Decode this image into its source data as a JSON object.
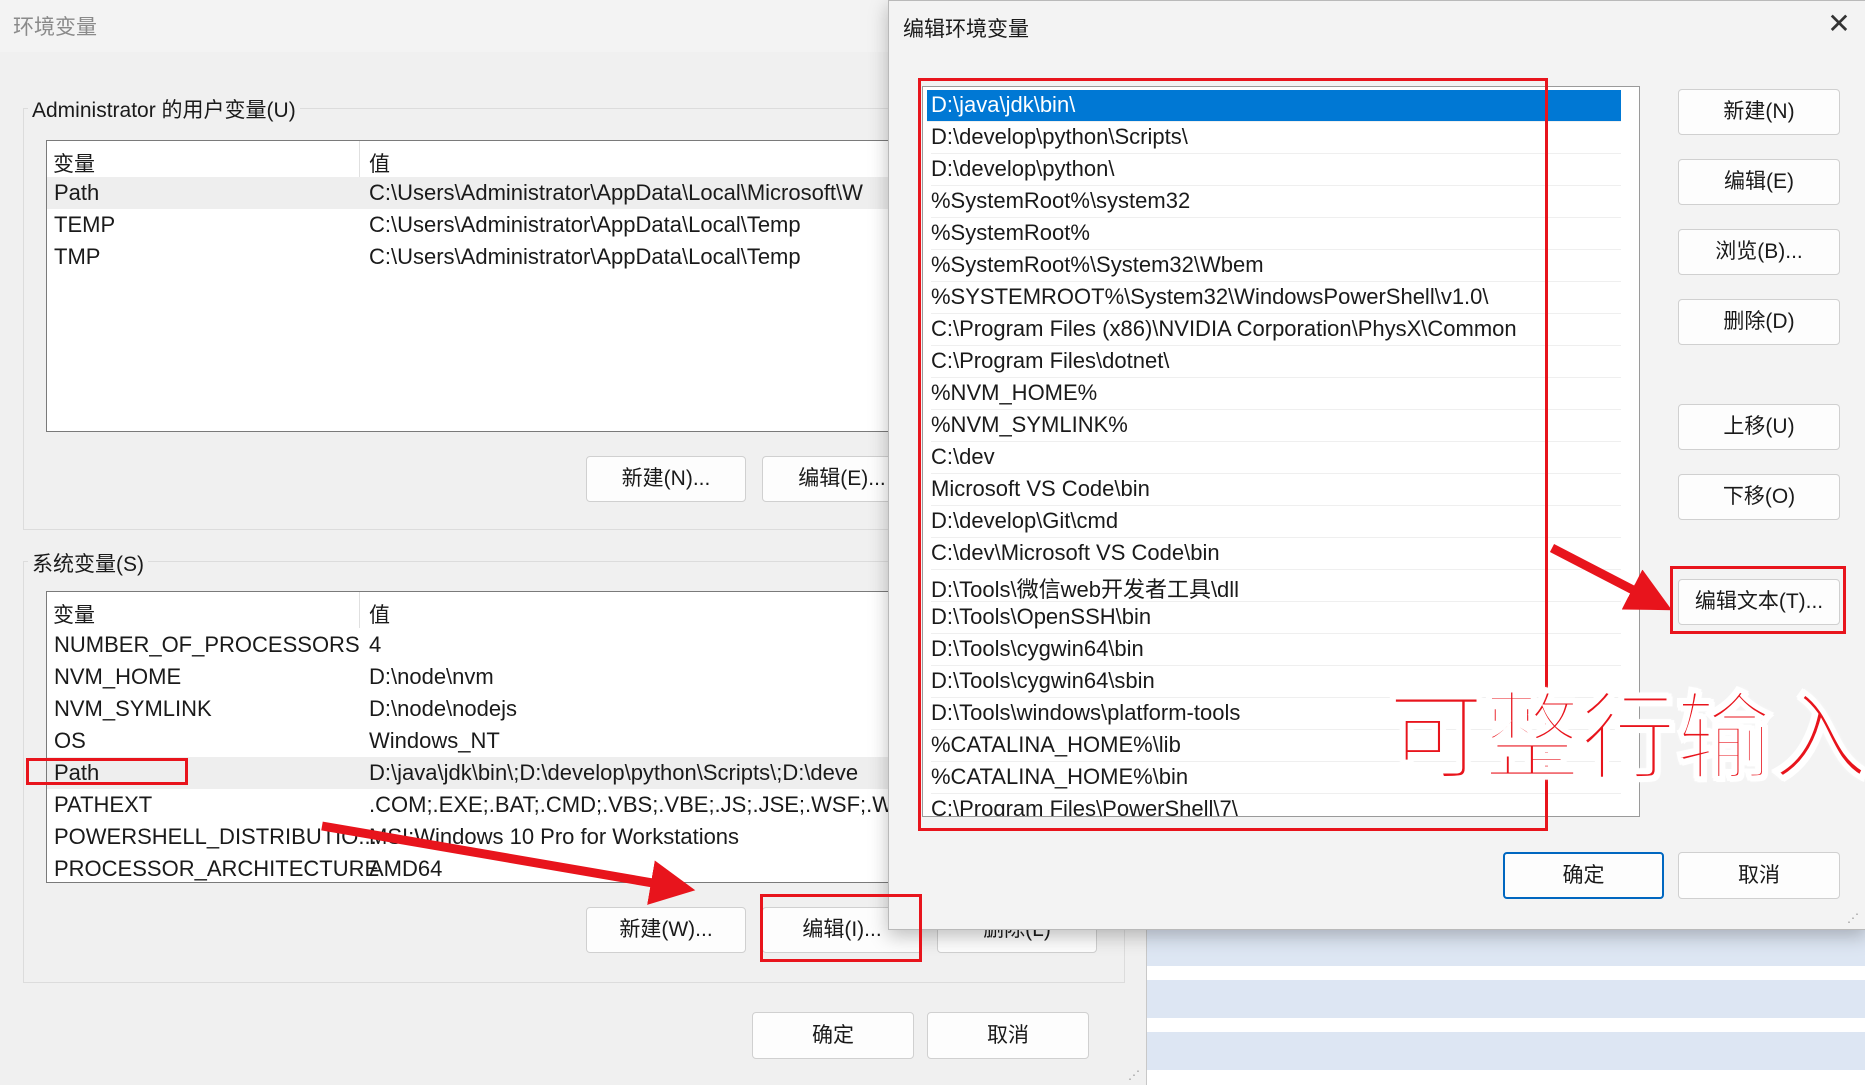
{
  "env_window": {
    "title": "环境变量",
    "user_group_label": "Administrator 的用户变量(U)",
    "columns": [
      "变量",
      "值"
    ],
    "user_vars": [
      {
        "name": "Path",
        "value": "C:\\Users\\Administrator\\AppData\\Local\\Microsoft\\W"
      },
      {
        "name": "TEMP",
        "value": "C:\\Users\\Administrator\\AppData\\Local\\Temp"
      },
      {
        "name": "TMP",
        "value": "C:\\Users\\Administrator\\AppData\\Local\\Temp"
      }
    ],
    "user_buttons": {
      "new": "新建(N)...",
      "edit": "编辑(E)..."
    },
    "system_group_label": "系统变量(S)",
    "system_vars": [
      {
        "name": "NUMBER_OF_PROCESSORS",
        "value": "4"
      },
      {
        "name": "NVM_HOME",
        "value": "D:\\node\\nvm"
      },
      {
        "name": "NVM_SYMLINK",
        "value": "D:\\node\\nodejs"
      },
      {
        "name": "OS",
        "value": "Windows_NT"
      },
      {
        "name": "Path",
        "value": "D:\\java\\jdk\\bin\\;D:\\develop\\python\\Scripts\\;D:\\deve"
      },
      {
        "name": "PATHEXT",
        "value": ".COM;.EXE;.BAT;.CMD;.VBS;.VBE;.JS;.JSE;.WSF;.WSH;.M"
      },
      {
        "name": "POWERSHELL_DISTRIBUTIO...",
        "value": "MSI:Windows 10 Pro for Workstations"
      },
      {
        "name": "PROCESSOR_ARCHITECTURE",
        "value": "AMD64"
      }
    ],
    "system_buttons": {
      "new": "新建(W)...",
      "edit": "编辑(I)...",
      "delete": "删除(L)"
    },
    "ok": "确定",
    "cancel": "取消"
  },
  "edit_window": {
    "title": "编辑环境变量",
    "close_icon": "close-icon",
    "paths": [
      "D:\\java\\jdk\\bin\\",
      "D:\\develop\\python\\Scripts\\",
      "D:\\develop\\python\\",
      "%SystemRoot%\\system32",
      "%SystemRoot%",
      "%SystemRoot%\\System32\\Wbem",
      "%SYSTEMROOT%\\System32\\WindowsPowerShell\\v1.0\\",
      "C:\\Program Files (x86)\\NVIDIA Corporation\\PhysX\\Common",
      "C:\\Program Files\\dotnet\\",
      "%NVM_HOME%",
      "%NVM_SYMLINK%",
      "C:\\dev",
      "Microsoft VS Code\\bin",
      "D:\\develop\\Git\\cmd",
      "C:\\dev\\Microsoft VS Code\\bin",
      "D:\\Tools\\微信web开发者工具\\dll",
      "D:\\Tools\\OpenSSH\\bin",
      "D:\\Tools\\cygwin64\\bin",
      "D:\\Tools\\cygwin64\\sbin",
      "D:\\Tools\\windows\\platform-tools",
      "%CATALINA_HOME%\\lib",
      "%CATALINA_HOME%\\bin",
      "C:\\Program Files\\PowerShell\\7\\"
    ],
    "buttons": {
      "new": "新建(N)",
      "edit": "编辑(E)",
      "browse": "浏览(B)...",
      "delete": "删除(D)",
      "up": "上移(U)",
      "down": "下移(O)",
      "edit_text": "编辑文本(T)..."
    },
    "ok": "确定",
    "cancel": "取消"
  },
  "annotation": {
    "text": "可整行输入",
    "color": "#e8141c"
  }
}
